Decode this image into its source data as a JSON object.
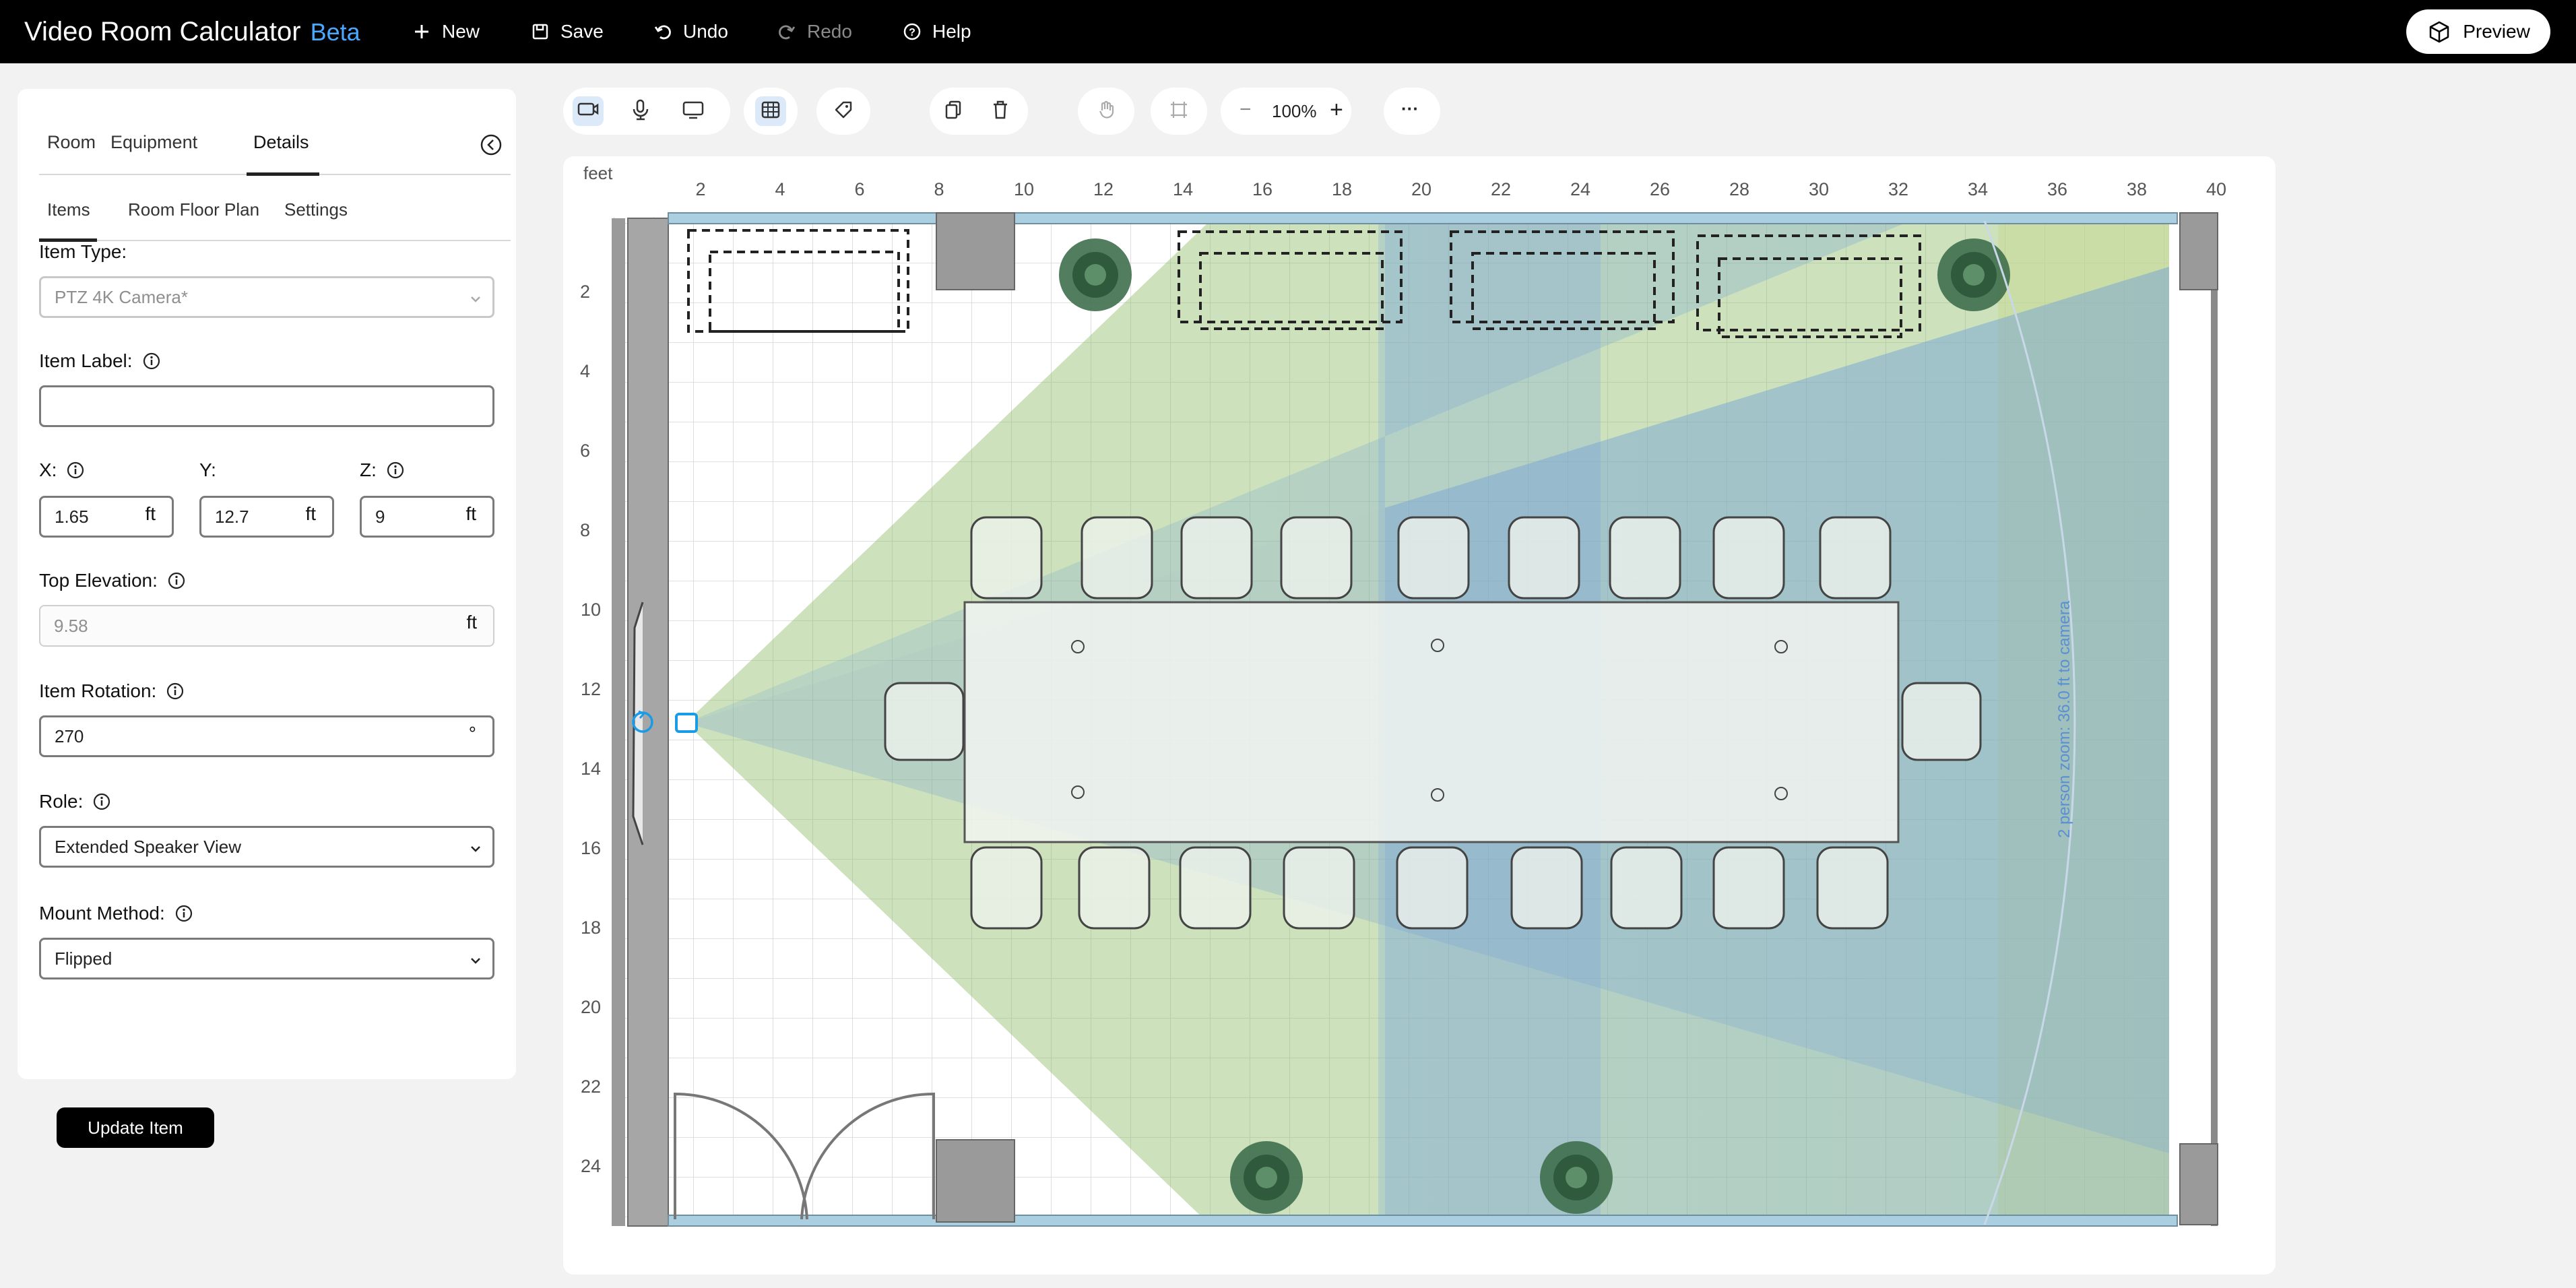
{
  "app": {
    "title": "Video Room Calculator",
    "badge": "Beta"
  },
  "topbar": {
    "new_label": "New",
    "save_label": "Save",
    "undo_label": "Undo",
    "redo_label": "Redo",
    "help_label": "Help",
    "preview_label": "Preview"
  },
  "panel": {
    "tabs": [
      "Room",
      "Equipment",
      "Details"
    ],
    "active_tab": "Details",
    "subtabs": [
      "Items",
      "Room Floor Plan",
      "Settings"
    ],
    "active_subtab": "Items",
    "item_type_label": "Item Type:",
    "item_type_value": "PTZ 4K Camera*",
    "item_label_label": "Item Label:",
    "item_label_value": "",
    "x_label": "X:",
    "x_value": "1.65",
    "y_label": "Y:",
    "y_value": "12.7",
    "z_label": "Z:",
    "z_value": "9",
    "unit_ft": "ft",
    "top_elevation_label": "Top Elevation:",
    "top_elevation_value": "9.58",
    "rotation_label": "Item Rotation:",
    "rotation_value": "270",
    "rotation_unit": "°",
    "role_label": "Role:",
    "role_value": "Extended Speaker View",
    "mount_label": "Mount Method:",
    "mount_value": "Flipped",
    "update_button": "Update Item"
  },
  "toolbar": {
    "zoom_value": "100%",
    "zoom_minus": "−",
    "zoom_plus": "+",
    "more": "···"
  },
  "floorplan": {
    "unit_label": "feet",
    "x_ticks": [
      "2",
      "4",
      "6",
      "8",
      "10",
      "12",
      "14",
      "16",
      "18",
      "20",
      "22",
      "24",
      "26",
      "28",
      "30",
      "32",
      "34",
      "36",
      "38",
      "40"
    ],
    "y_ticks": [
      "2",
      "4",
      "6",
      "8",
      "10",
      "12",
      "14",
      "16",
      "18",
      "20",
      "22",
      "24"
    ],
    "zoom_annotation": "2 person zoom: 36.0 ft to camera",
    "colors": {
      "wide_view": "#8fbd6a",
      "tele_view": "#8fb5de",
      "zoom_limit": "#f5f0b0",
      "wall": "#9a9a9a",
      "window": "#a9cfe0",
      "selection": "#1a9be8"
    }
  }
}
